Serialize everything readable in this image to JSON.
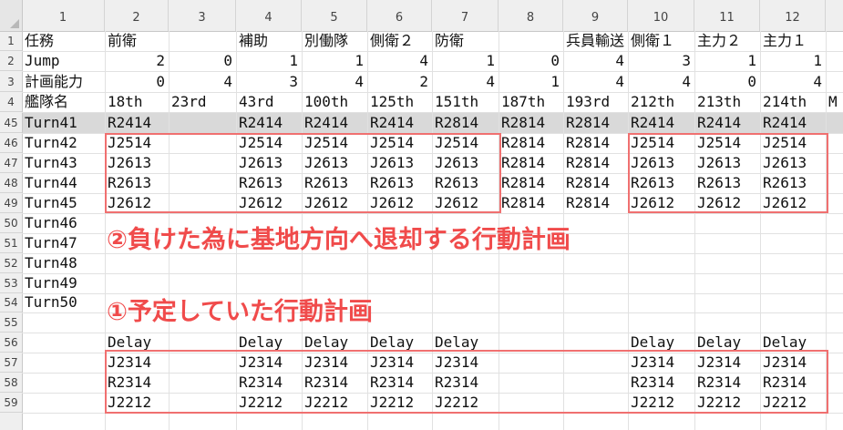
{
  "columns": [
    "1",
    "2",
    "3",
    "4",
    "5",
    "6",
    "7",
    "8",
    "9",
    "10",
    "11",
    "12"
  ],
  "rows": [
    "1",
    "2",
    "3",
    "4",
    "45",
    "46",
    "47",
    "48",
    "49",
    "50",
    "51",
    "52",
    "53",
    "54",
    "55",
    "56",
    "57",
    "58",
    "59"
  ],
  "header_rows": {
    "r1": [
      "任務",
      "前衛",
      "",
      "補助",
      "別働隊",
      "側衛２",
      "防衛",
      "",
      "兵員輸送",
      "側衛１",
      "主力２",
      "主力１"
    ],
    "r2": [
      "Jump",
      "2",
      "0",
      "1",
      "1",
      "4",
      "1",
      "0",
      "4",
      "3",
      "1",
      "1"
    ],
    "r3": [
      "計画能力",
      "0",
      "4",
      "3",
      "4",
      "2",
      "4",
      "1",
      "4",
      "4",
      "0",
      "4"
    ],
    "r4": [
      "艦隊名",
      "18th",
      "23rd",
      "43rd",
      "100th",
      "125th",
      "151th",
      "187th",
      "193rd",
      "212th",
      "213th",
      "214th",
      "M"
    ]
  },
  "turn_rows": [
    [
      "Turn41",
      "R2414",
      "",
      "R2414",
      "R2414",
      "R2414",
      "R2814",
      "R2814",
      "R2814",
      "R2414",
      "R2414",
      "R2414"
    ],
    [
      "Turn42",
      "J2514",
      "",
      "J2514",
      "J2514",
      "J2514",
      "J2514",
      "R2814",
      "R2814",
      "J2514",
      "J2514",
      "J2514"
    ],
    [
      "Turn43",
      "J2613",
      "",
      "J2613",
      "J2613",
      "J2613",
      "J2613",
      "R2814",
      "R2814",
      "J2613",
      "J2613",
      "J2613"
    ],
    [
      "Turn44",
      "R2613",
      "",
      "R2613",
      "R2613",
      "R2613",
      "R2613",
      "R2814",
      "R2814",
      "R2613",
      "R2613",
      "R2613"
    ],
    [
      "Turn45",
      "J2612",
      "",
      "J2612",
      "J2612",
      "J2612",
      "J2612",
      "R2814",
      "R2814",
      "J2612",
      "J2612",
      "J2612"
    ],
    [
      "Turn46"
    ],
    [
      "Turn47"
    ],
    [
      "Turn48"
    ],
    [
      "Turn49"
    ],
    [
      "Turn50"
    ]
  ],
  "plan_rows": [
    [
      "",
      "Delay",
      "",
      "Delay",
      "Delay",
      "Delay",
      "Delay",
      "",
      "",
      "Delay",
      "Delay",
      "Delay"
    ],
    [
      "",
      "J2314",
      "",
      "J2314",
      "J2314",
      "J2314",
      "J2314",
      "",
      "",
      "J2314",
      "J2314",
      "J2314"
    ],
    [
      "",
      "R2314",
      "",
      "R2314",
      "R2314",
      "R2314",
      "R2314",
      "",
      "",
      "R2314",
      "R2314",
      "R2314"
    ],
    [
      "",
      "J2212",
      "",
      "J2212",
      "J2212",
      "J2212",
      "J2212",
      "",
      "",
      "J2212",
      "J2212",
      "J2212"
    ]
  ],
  "annotations": {
    "retreat": "②負けた為に基地方向へ退却する行動計画",
    "planned": "①予定していた行動計画"
  },
  "colors": {
    "highlight_row": "#d9d9d9",
    "annotation": "#f04b4b",
    "box": "#f07070"
  }
}
